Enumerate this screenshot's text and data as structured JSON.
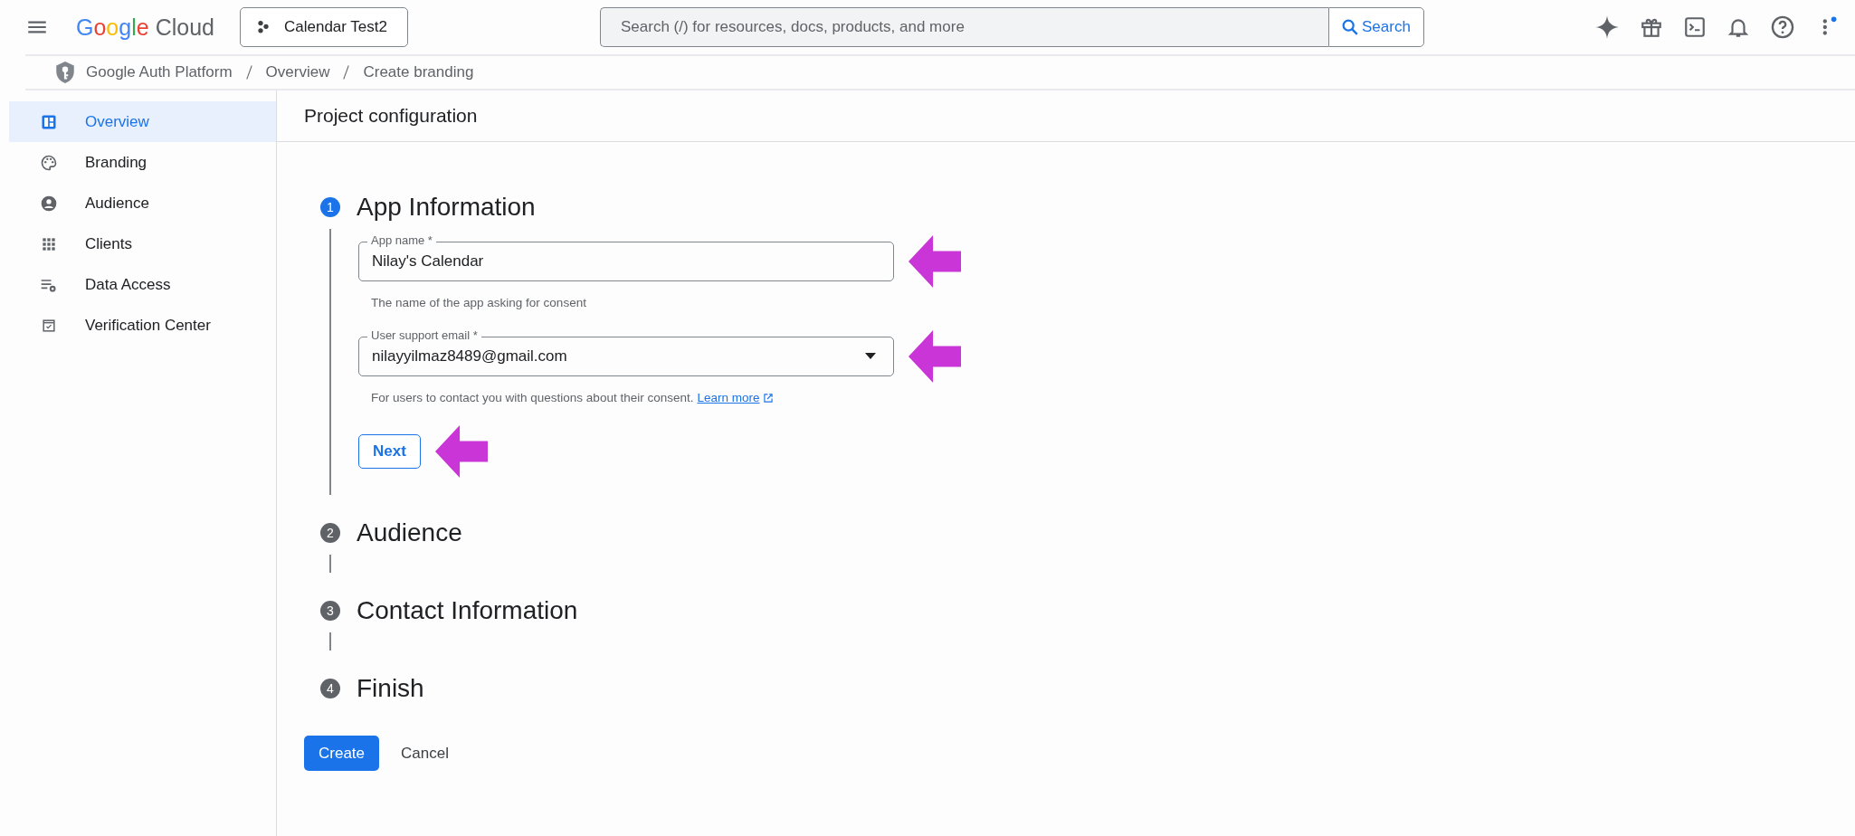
{
  "top_bar": {
    "logo_brand": "Google",
    "logo_product": "Cloud",
    "project": "Calendar Test2",
    "search": {
      "placeholder": "Search (/) for resources, docs, products, and more",
      "button": "Search"
    },
    "notification_dot": true
  },
  "breadcrumb": [
    "Google Auth Platform",
    "Overview",
    "Create branding"
  ],
  "sidebar": {
    "items": [
      {
        "label": "Overview",
        "selected": true
      },
      {
        "label": "Branding",
        "selected": false
      },
      {
        "label": "Audience",
        "selected": false
      },
      {
        "label": "Clients",
        "selected": false
      },
      {
        "label": "Data Access",
        "selected": false
      },
      {
        "label": "Verification Center",
        "selected": false
      }
    ]
  },
  "page_title": "Project configuration",
  "steps": [
    {
      "number": "1",
      "title": "App Information",
      "active": true
    },
    {
      "number": "2",
      "title": "Audience",
      "active": false
    },
    {
      "number": "3",
      "title": "Contact Information",
      "active": false
    },
    {
      "number": "4",
      "title": "Finish",
      "active": false
    }
  ],
  "form": {
    "fields": [
      {
        "kind": "text",
        "label": "App name *",
        "value": "Nilay's Calendar",
        "helper": "The name of the app asking for consent",
        "highlighted": true
      },
      {
        "kind": "select",
        "label": "User support email *",
        "value": "nilayyilmaz8489@gmail.com",
        "helper": "For users to contact you with questions about their consent.",
        "link": "Learn more",
        "highlighted": true
      }
    ],
    "next_button": {
      "label": "Next",
      "highlighted": true
    }
  },
  "actions": {
    "primary": "Create",
    "secondary": "Cancel"
  }
}
